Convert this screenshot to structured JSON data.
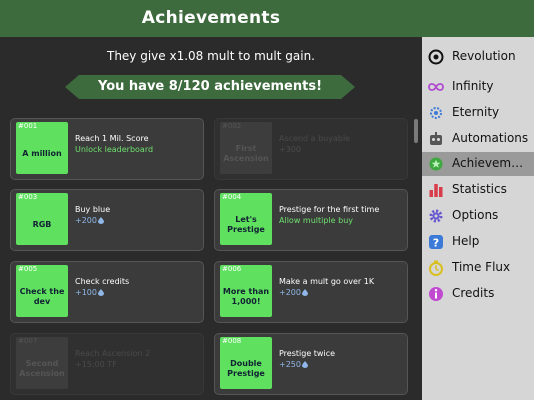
{
  "header": {
    "title": "Achievements"
  },
  "summary": {
    "mult_text": "They give x1.08 mult to mult gain.",
    "count_text": "You have 8/120 achievements!"
  },
  "achievements": [
    {
      "num": "#001",
      "name": "A million",
      "desc": "Reach 1 Mil. Score",
      "reward": "Unlock leaderboard",
      "locked": false
    },
    {
      "num": "#002",
      "name": "First Ascension",
      "desc": "Ascend a buyable",
      "reward": "+300",
      "locked": true
    },
    {
      "num": "#003",
      "name": "RGB",
      "desc": "Buy blue",
      "reward": "+200",
      "locked": false
    },
    {
      "num": "#004",
      "name": "Let's Prestige",
      "desc": "Prestige for the first time",
      "reward": "Allow multiple buy",
      "locked": false
    },
    {
      "num": "#005",
      "name": "Check the dev",
      "desc": "Check credits",
      "reward": "+100",
      "locked": false
    },
    {
      "num": "#006",
      "name": "More than 1,000!",
      "desc": "Make a mult go over 1K",
      "reward": "+200",
      "locked": false
    },
    {
      "num": "#007",
      "name": "Second Ascension",
      "desc": "Reach Ascension 2",
      "reward": "+15:00 TF",
      "locked": true
    },
    {
      "num": "#008",
      "name": "Double Prestige",
      "desc": "Prestige twice",
      "reward": "+250",
      "locked": false
    }
  ],
  "sidebar": {
    "items": [
      {
        "label": "Revolution",
        "icon": "revolution-icon",
        "color": "#111111"
      },
      {
        "label": "Infinity",
        "icon": "infinity-icon",
        "color": "#b04ad0"
      },
      {
        "label": "Eternity",
        "icon": "eternity-icon",
        "color": "#3c7ad8"
      },
      {
        "label": "Automations",
        "icon": "robot-icon",
        "color": "#555555"
      },
      {
        "label": "Achievem…",
        "icon": "achievement-icon",
        "color": "#3ea83e"
      },
      {
        "label": "Statistics",
        "icon": "statistics-icon",
        "color": "#d83c4a"
      },
      {
        "label": "Options",
        "icon": "gear-icon",
        "color": "#6a5ad0"
      },
      {
        "label": "Help",
        "icon": "help-icon",
        "color": "#3c7ad8"
      },
      {
        "label": "Time Flux",
        "icon": "time-flux-icon",
        "color": "#d8c020"
      },
      {
        "label": "Credits",
        "icon": "credits-icon",
        "color": "#c04ad0"
      }
    ]
  },
  "colors": {
    "accent": "#3e6b3e",
    "tile": "#5fe15f",
    "reward_green": "#6fe06f",
    "reward_blue": "#8fb8e8"
  }
}
